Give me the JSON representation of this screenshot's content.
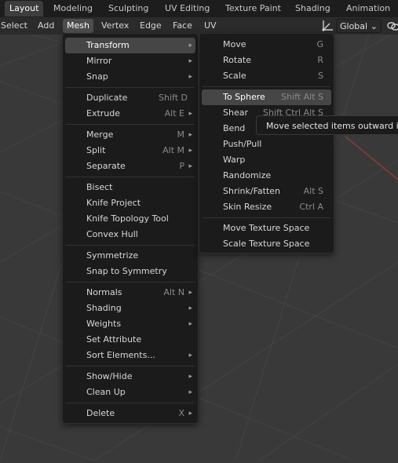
{
  "workspace_tabs": [
    "Layout",
    "Modeling",
    "Sculpting",
    "UV Editing",
    "Texture Paint",
    "Shading",
    "Animation"
  ],
  "menubar": {
    "items": [
      "Select",
      "Add",
      "Mesh",
      "Vertex",
      "Edge",
      "Face",
      "UV"
    ],
    "orientation": "Global",
    "orientation_chevron": "⌄"
  },
  "mesh_menu": {
    "items": [
      {
        "label": "Transform",
        "shortcut": "",
        "arrow": "▸"
      },
      {
        "label": "Mirror",
        "shortcut": "",
        "arrow": "▸"
      },
      {
        "label": "Snap",
        "shortcut": "",
        "arrow": "▸"
      },
      {
        "label": "Duplicate",
        "shortcut": "Shift D",
        "arrow": ""
      },
      {
        "label": "Extrude",
        "shortcut": "Alt E",
        "arrow": "▸"
      },
      {
        "label": "Merge",
        "shortcut": "M",
        "arrow": "▸"
      },
      {
        "label": "Split",
        "shortcut": "Alt M",
        "arrow": "▸"
      },
      {
        "label": "Separate",
        "shortcut": "P",
        "arrow": "▸"
      },
      {
        "label": "Bisect",
        "shortcut": "",
        "arrow": ""
      },
      {
        "label": "Knife Project",
        "shortcut": "",
        "arrow": ""
      },
      {
        "label": "Knife Topology Tool",
        "shortcut": "",
        "arrow": ""
      },
      {
        "label": "Convex Hull",
        "shortcut": "",
        "arrow": ""
      },
      {
        "label": "Symmetrize",
        "shortcut": "",
        "arrow": ""
      },
      {
        "label": "Snap to Symmetry",
        "shortcut": "",
        "arrow": ""
      },
      {
        "label": "Normals",
        "shortcut": "Alt N",
        "arrow": "▸"
      },
      {
        "label": "Shading",
        "shortcut": "",
        "arrow": "▸"
      },
      {
        "label": "Weights",
        "shortcut": "",
        "arrow": "▸"
      },
      {
        "label": "Set Attribute",
        "shortcut": "",
        "arrow": ""
      },
      {
        "label": "Sort Elements...",
        "shortcut": "",
        "arrow": "▸"
      },
      {
        "label": "Show/Hide",
        "shortcut": "",
        "arrow": "▸"
      },
      {
        "label": "Clean Up",
        "shortcut": "",
        "arrow": "▸"
      },
      {
        "label": "Delete",
        "shortcut": "X",
        "arrow": "▸"
      }
    ]
  },
  "transform_menu": {
    "items": [
      {
        "label": "Move",
        "shortcut": "G"
      },
      {
        "label": "Rotate",
        "shortcut": "R"
      },
      {
        "label": "Scale",
        "shortcut": "S"
      },
      {
        "label": "To Sphere",
        "shortcut": "Shift Alt S"
      },
      {
        "label": "Shear",
        "shortcut": "Shift Ctrl Alt S"
      },
      {
        "label": "Bend",
        "shortcut": ""
      },
      {
        "label": "Push/Pull",
        "shortcut": ""
      },
      {
        "label": "Warp",
        "shortcut": ""
      },
      {
        "label": "Randomize",
        "shortcut": ""
      },
      {
        "label": "Shrink/Fatten",
        "shortcut": "Alt S"
      },
      {
        "label": "Skin Resize",
        "shortcut": "Ctrl A"
      },
      {
        "label": "Move Texture Space",
        "shortcut": ""
      },
      {
        "label": "Scale Texture Space",
        "shortcut": ""
      }
    ]
  },
  "tooltip": "Move selected items outward in",
  "colors": {
    "background": "#393939",
    "grid_line": "#444444",
    "x_axis": "#8a3a3a",
    "menu_bg": "#1b1b1b",
    "highlight": "#464646"
  },
  "icons": [
    "orientation-gizmo-icon",
    "link-icon",
    "chevron-down-icon",
    "submenu-arrow-icon"
  ]
}
